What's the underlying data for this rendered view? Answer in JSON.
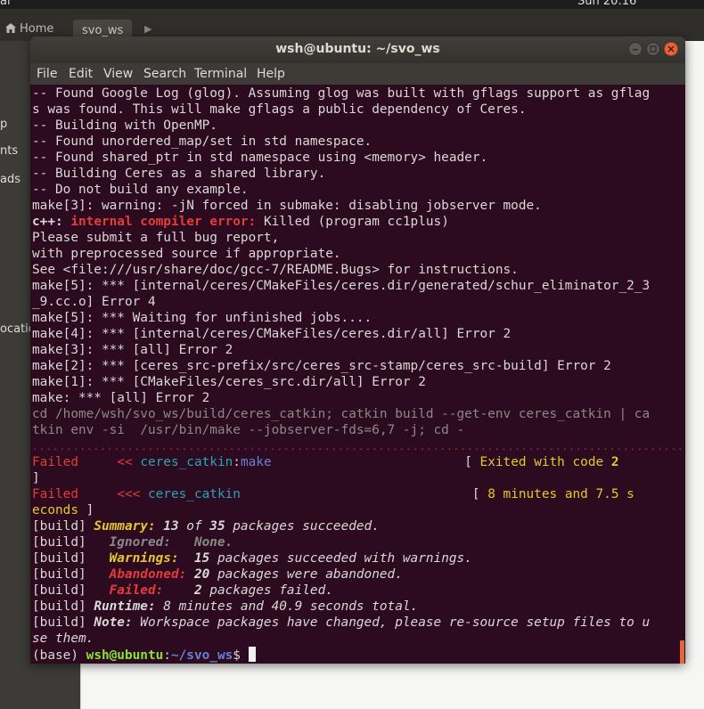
{
  "desktop": {
    "menu_label": "al",
    "clock": "Sun 20:16",
    "power_icon": "chevron-down-icon"
  },
  "files": {
    "home_label": "Home",
    "current_folder": "svo_ws",
    "sidebar_fragments": [
      "p",
      "nts",
      "ads",
      "ocatio"
    ]
  },
  "terminal": {
    "title": "wsh@ubuntu: ~/svo_ws",
    "menu": [
      "File",
      "Edit",
      "View",
      "Search",
      "Terminal",
      "Help"
    ],
    "lines": [
      [
        {
          "t": "-- Found Google Log (glog). Assuming glog was built with gflags support as gflag"
        }
      ],
      [
        {
          "t": "s was found. This will make gflags a public dependency of Ceres."
        }
      ],
      [
        {
          "t": "-- Building with OpenMP."
        }
      ],
      [
        {
          "t": "-- Found unordered_map/set in std namespace."
        }
      ],
      [
        {
          "t": "-- Found shared_ptr in std namespace using <memory> header."
        }
      ],
      [
        {
          "t": "-- Building Ceres as a shared library."
        }
      ],
      [
        {
          "t": "-- Do not build any example."
        }
      ],
      [
        {
          "t": "make[3]: warning: -jN forced in submake: disabling jobserver mode."
        }
      ],
      [
        {
          "t": "c++: ",
          "c": "b"
        },
        {
          "t": "internal compiler error: ",
          "c": "b red"
        },
        {
          "t": "Killed (program cc1plus)"
        }
      ],
      [
        {
          "t": "Please submit a full bug report,"
        }
      ],
      [
        {
          "t": "with preprocessed source if appropriate."
        }
      ],
      [
        {
          "t": "See <file:///usr/share/doc/gcc-7/README.Bugs> for instructions."
        }
      ],
      [
        {
          "t": "make[5]: *** [internal/ceres/CMakeFiles/ceres.dir/generated/schur_eliminator_2_3"
        }
      ],
      [
        {
          "t": "_9.cc.o] Error 4"
        }
      ],
      [
        {
          "t": "make[5]: *** Waiting for unfinished jobs...."
        }
      ],
      [
        {
          "t": "make[4]: *** [internal/ceres/CMakeFiles/ceres.dir/all] Error 2"
        }
      ],
      [
        {
          "t": "make[3]: *** [all] Error 2"
        }
      ],
      [
        {
          "t": "make[2]: *** [ceres_src-prefix/src/ceres_src-stamp/ceres_src-build] Error 2"
        }
      ],
      [
        {
          "t": "make[1]: *** [CMakeFiles/ceres_src.dir/all] Error 2"
        }
      ],
      [
        {
          "t": "make: *** [all] Error 2"
        }
      ],
      [
        {
          "t": "cd /home/wsh/svo_ws/build/ceres_catkin; catkin build --get-env ceres_catkin | ca",
          "c": "grey"
        }
      ],
      [
        {
          "t": "tkin env -si  /usr/bin/make --jobserver-fds=6,7 -j; cd -",
          "c": "grey"
        }
      ],
      [
        {
          "t": "..................................................................................................................",
          "c": "dots"
        }
      ],
      [
        {
          "t": "Failed",
          "c": "red"
        },
        {
          "t": "     "
        },
        {
          "t": "<<",
          "c": "red"
        },
        {
          "t": " "
        },
        {
          "t": "ceres_catkin",
          "c": "cyan"
        },
        {
          "t": ":"
        },
        {
          "t": "make",
          "c": "blue"
        },
        {
          "t": "                         [ "
        },
        {
          "t": "Exited with code ",
          "c": "yellow"
        },
        {
          "t": "2",
          "c": "b yellow"
        }
      ],
      [
        {
          "t": "]"
        }
      ],
      [
        {
          "t": "Failed",
          "c": "red"
        },
        {
          "t": "     "
        },
        {
          "t": "<<<",
          "c": "red"
        },
        {
          "t": " "
        },
        {
          "t": "ceres_catkin",
          "c": "cyan"
        },
        {
          "t": "                              [ "
        },
        {
          "t": "8 minutes and 7.5 s",
          "c": "yellow"
        }
      ],
      [
        {
          "t": "econds",
          "c": "yellow"
        },
        {
          "t": " ]"
        }
      ],
      [
        {
          "t": "[build] "
        },
        {
          "t": "Summary: ",
          "c": "b i yellow"
        },
        {
          "t": "13",
          "c": "b i"
        },
        {
          "t": " of ",
          "c": "i"
        },
        {
          "t": "35",
          "c": "b i"
        },
        {
          "t": " packages succeeded.",
          "c": "i"
        }
      ],
      [
        {
          "t": "[build]   "
        },
        {
          "t": "Ignored:   None.",
          "c": "b i grey"
        }
      ],
      [
        {
          "t": "[build]   "
        },
        {
          "t": "Warnings:  ",
          "c": "b i yellow"
        },
        {
          "t": "15",
          "c": "b i"
        },
        {
          "t": " packages succeeded with warnings.",
          "c": "i"
        }
      ],
      [
        {
          "t": "[build]   "
        },
        {
          "t": "Abandoned: ",
          "c": "b i red"
        },
        {
          "t": "20",
          "c": "b i"
        },
        {
          "t": " packages were abandoned.",
          "c": "i"
        }
      ],
      [
        {
          "t": "[build]   "
        },
        {
          "t": "Failed:    ",
          "c": "b i red"
        },
        {
          "t": "2",
          "c": "b i"
        },
        {
          "t": " packages failed.",
          "c": "i"
        }
      ],
      [
        {
          "t": "[build] "
        },
        {
          "t": "Runtime: ",
          "c": "b i"
        },
        {
          "t": "8 minutes and 40.9 seconds total.",
          "c": "i"
        }
      ],
      [
        {
          "t": "[build] "
        },
        {
          "t": "Note: ",
          "c": "b i"
        },
        {
          "t": "Workspace packages have changed, please re-source setup files to u",
          "c": "i"
        }
      ],
      [
        {
          "t": "se them.",
          "c": "i"
        }
      ],
      [
        {
          "t": "(base) "
        },
        {
          "t": "wsh@ubuntu",
          "c": "b green"
        },
        {
          "t": ":"
        },
        {
          "t": "~/svo_ws",
          "c": "b blue"
        },
        {
          "t": "$ "
        }
      ]
    ]
  },
  "colors": {
    "terminal_bg": "#2c0a1f",
    "close_button": "#e8643a",
    "error_red": "#e53b3b",
    "package_cyan": "#2aa3b8",
    "warning_yellow": "#e4c92a"
  }
}
